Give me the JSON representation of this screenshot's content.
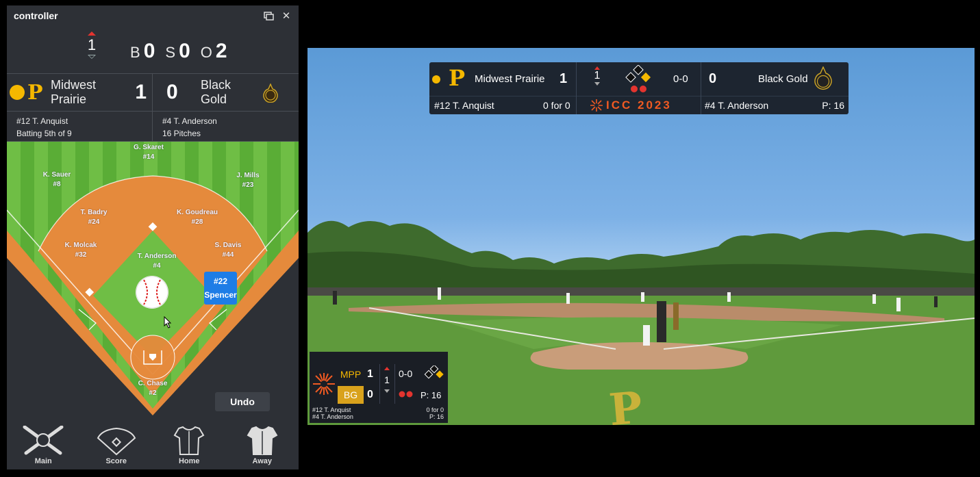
{
  "controller": {
    "title": "controller",
    "inning": "1",
    "count": {
      "balls_label": "B",
      "balls": "0",
      "strikes_label": "S",
      "strikes": "0",
      "outs_label": "O",
      "outs": "2"
    },
    "home": {
      "name_line1": "Midwest",
      "name_line2": "Prairie",
      "score": "1",
      "color": "#f5b800"
    },
    "away": {
      "name_line1": "Black",
      "name_line2": "Gold",
      "score": "0"
    },
    "batter": {
      "name": "#12 T. Anquist",
      "detail": "Batting 5th of 9"
    },
    "pitcher": {
      "name": "#4 T. Anderson",
      "detail": "16 Pitches"
    },
    "fielders": [
      {
        "name": "G. Skaret",
        "num": "#14"
      },
      {
        "name": "K. Sauer",
        "num": "#8"
      },
      {
        "name": "J. Mills",
        "num": "#23"
      },
      {
        "name": "T. Badry",
        "num": "#24"
      },
      {
        "name": "K. Goudreau",
        "num": "#28"
      },
      {
        "name": "K. Molcak",
        "num": "#32"
      },
      {
        "name": "S. Davis",
        "num": "#44"
      },
      {
        "name": "T. Anderson",
        "num": "#4"
      },
      {
        "name": "C. Chase",
        "num": "#2"
      }
    ],
    "runner": {
      "num": "#22",
      "name": "Spencer"
    },
    "undo_label": "Undo",
    "nav": [
      {
        "label": "Main",
        "icon": "baseball-bats-icon"
      },
      {
        "label": "Score",
        "icon": "baseball-diamond-icon"
      },
      {
        "label": "Home",
        "icon": "home-jersey-icon"
      },
      {
        "label": "Away",
        "icon": "away-jersey-icon"
      }
    ]
  },
  "scorebug": {
    "home_name": "Midwest Prairie",
    "home_score": "1",
    "inning": "1",
    "count": "0-0",
    "away_score": "0",
    "away_name": "Black Gold",
    "batter": "#12 T. Anquist",
    "batter_stat": "0 for 0",
    "event_logo": "ICC 2023",
    "pitcher": "#4 T. Anderson",
    "pitch_count": "P: 16"
  },
  "mini_bug": {
    "home_abbr": "MPP",
    "home_score": "1",
    "away_abbr": "BG",
    "away_score": "0",
    "inning": "1",
    "count": "0-0",
    "pitch_count": "P: 16",
    "batter": "#12 T. Anquist",
    "batter_stat": "0 for 0",
    "pitcher": "#4 T. Anderson",
    "pitcher_stat": "P: 16"
  },
  "colors": {
    "gold": "#f5b800",
    "accent_red": "#e3342f",
    "orange": "#f05a22",
    "runner_blue": "#1e7de6"
  }
}
